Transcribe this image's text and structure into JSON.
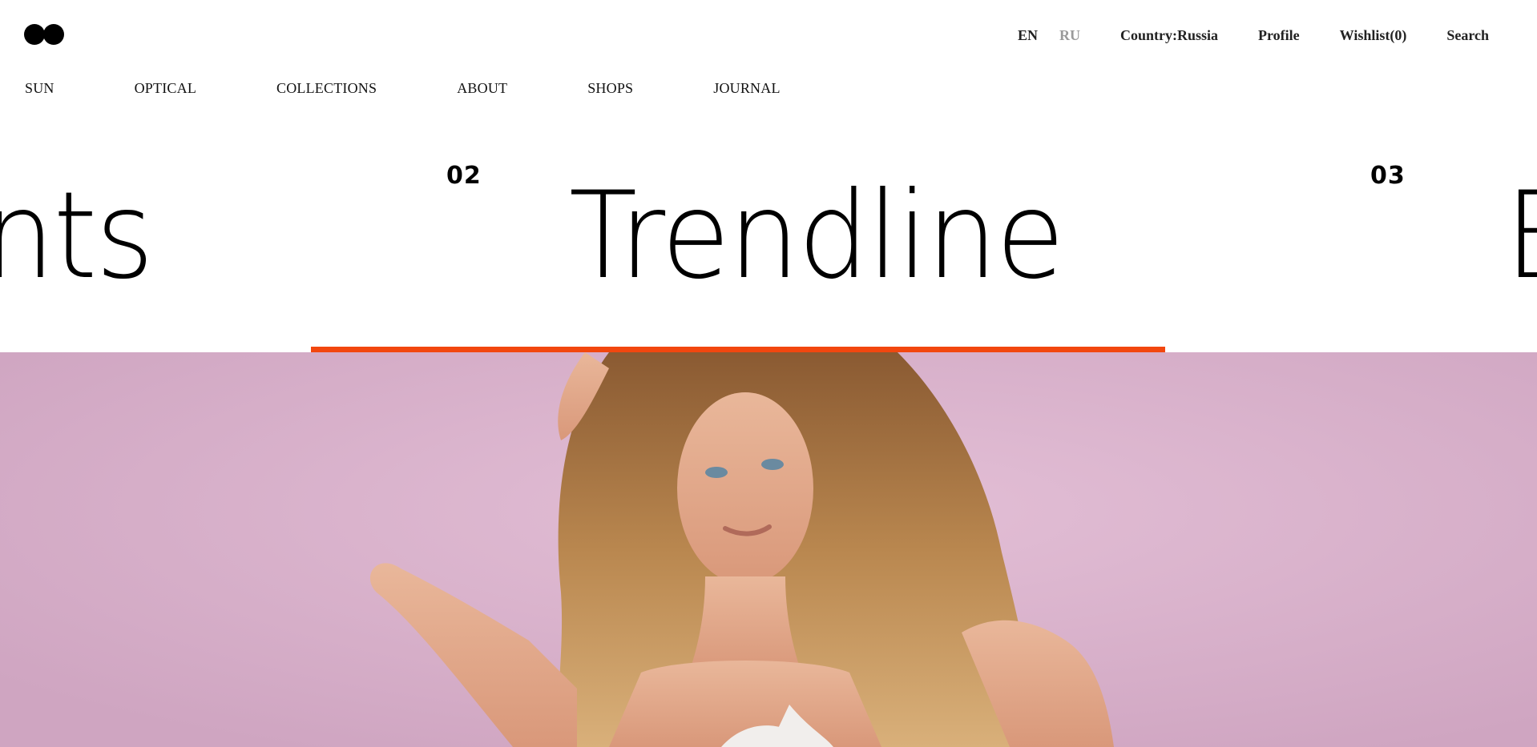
{
  "logo": {
    "icon": "logo-two-dots-icon"
  },
  "topbar": {
    "lang_en": "EN",
    "lang_ru": "RU",
    "country": "Country:Russia",
    "profile": "Profile",
    "wishlist": "Wishlist(0)",
    "search": "Search"
  },
  "nav": {
    "items": [
      "SUN",
      "OPTICAL",
      "COLLECTIONS",
      "ABOUT",
      "SHOPS",
      "JOURNAL"
    ]
  },
  "slider": {
    "slides": [
      {
        "number": "",
        "title": "nts"
      },
      {
        "number": "02",
        "title": "Trendline"
      },
      {
        "number": "03",
        "title": "E"
      }
    ],
    "active_index": 1
  },
  "colors": {
    "accent": "#f2470f",
    "hero_bg": "#dbb2cc",
    "inactive_lang": "#9a9a9a"
  },
  "hero": {
    "image": "woman-with-long-wavy-hair-on-pink-wall"
  }
}
